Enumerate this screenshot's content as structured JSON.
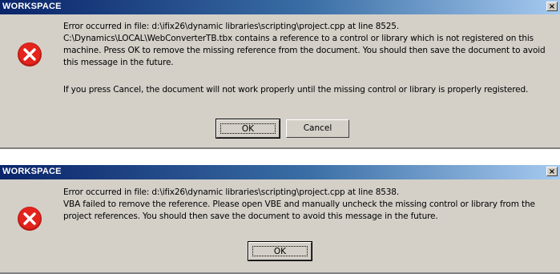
{
  "dialogs": [
    {
      "title": "WORKSPACE",
      "close_label": "×",
      "icon": "error-icon",
      "message_lines": [
        "Error occurred in file: d:\\ifix26\\dynamic libraries\\scripting\\project.cpp at line 8525.",
        "C:\\Dynamics\\LOCAL\\WebConverterTB.tbx contains a reference to a control or library which is not registered on this",
        "machine.  Press OK to remove the missing reference from the document. You should then save the document to avoid",
        "this message in the future."
      ],
      "message_line_extra": "If you press Cancel, the document will not work properly until the missing control or library is properly registered.",
      "ok_label": "OK",
      "cancel_label": "Cancel"
    },
    {
      "title": "WORKSPACE",
      "close_label": "×",
      "icon": "error-icon",
      "message_lines": [
        "Error occurred in file: d:\\ifix26\\dynamic libraries\\scripting\\project.cpp at line 8538.",
        "VBA failed to remove the reference. Please open VBE and manually uncheck the missing control or library from the",
        "project references. You should then save the document to avoid this message in the future."
      ],
      "ok_label": "OK"
    }
  ],
  "colors": {
    "title_start": "#0a246a",
    "title_end": "#a6caf0",
    "dialog_bg": "#d4d0c8",
    "error_red": "#e3231c"
  }
}
